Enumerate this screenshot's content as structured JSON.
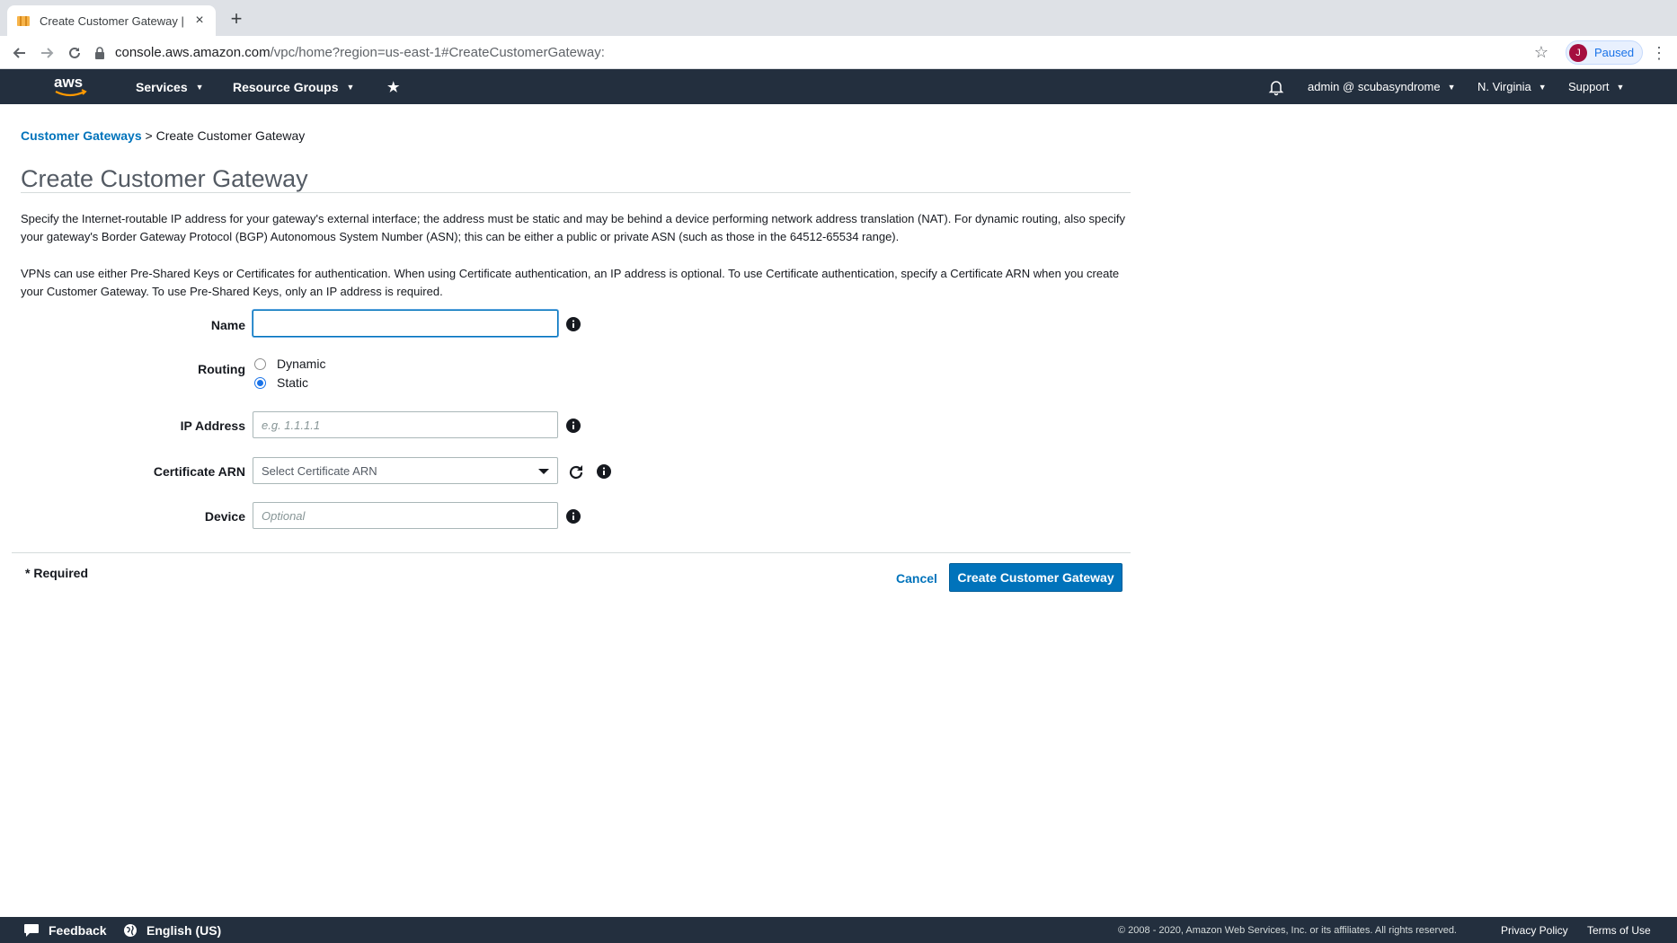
{
  "browser": {
    "tab_title": "Create Customer Gateway | VP",
    "tab_close": "×",
    "new_tab": "+",
    "url_host": "console.aws.amazon.com",
    "url_path": "/vpc/home?region=us-east-1#CreateCustomerGateway:",
    "profile_initial": "J",
    "profile_label": "Paused"
  },
  "aws_nav": {
    "logo_text": "aws",
    "services": "Services",
    "resource_groups": "Resource Groups",
    "pin": "★",
    "account": "admin @ scubasyndrome",
    "region": "N. Virginia",
    "support": "Support",
    "caret": "▼"
  },
  "breadcrumb": {
    "parent": "Customer Gateways",
    "separator": " > ",
    "current": "Create Customer Gateway"
  },
  "page": {
    "title": "Create Customer Gateway",
    "para1": "Specify the Internet-routable IP address for your gateway's external interface; the address must be static and may be behind a device performing network address translation (NAT). For dynamic routing, also specify your gateway's Border Gateway Protocol (BGP) Autonomous System Number (ASN); this can be either a public or private ASN (such as those in the 64512-65534 range).",
    "para2": "VPNs can use either Pre-Shared Keys or Certificates for authentication. When using Certificate authentication, an IP address is optional. To use Certificate authentication, specify a Certificate ARN when you create your Customer Gateway. To use Pre-Shared Keys, only an IP address is required."
  },
  "form": {
    "name_label": "Name",
    "name_value": "",
    "routing_label": "Routing",
    "routing_options": [
      "Dynamic",
      "Static"
    ],
    "routing_selected": "Static",
    "ip_label": "IP Address",
    "ip_placeholder": "e.g. 1.1.1.1",
    "cert_label": "Certificate ARN",
    "cert_selected": "Select Certificate ARN",
    "device_label": "Device",
    "device_placeholder": "Optional",
    "required_note": "* Required",
    "cancel": "Cancel",
    "submit": "Create Customer Gateway"
  },
  "footer": {
    "feedback": "Feedback",
    "language": "English (US)",
    "copyright": "© 2008 - 2020, Amazon Web Services, Inc. or its affiliates. All rights reserved.",
    "privacy": "Privacy Policy",
    "terms": "Terms of Use"
  },
  "colors": {
    "aws_nav_bg": "#232f3e",
    "link": "#0073bb",
    "primary_button": "#0073bb",
    "aws_orange": "#ff9900"
  }
}
